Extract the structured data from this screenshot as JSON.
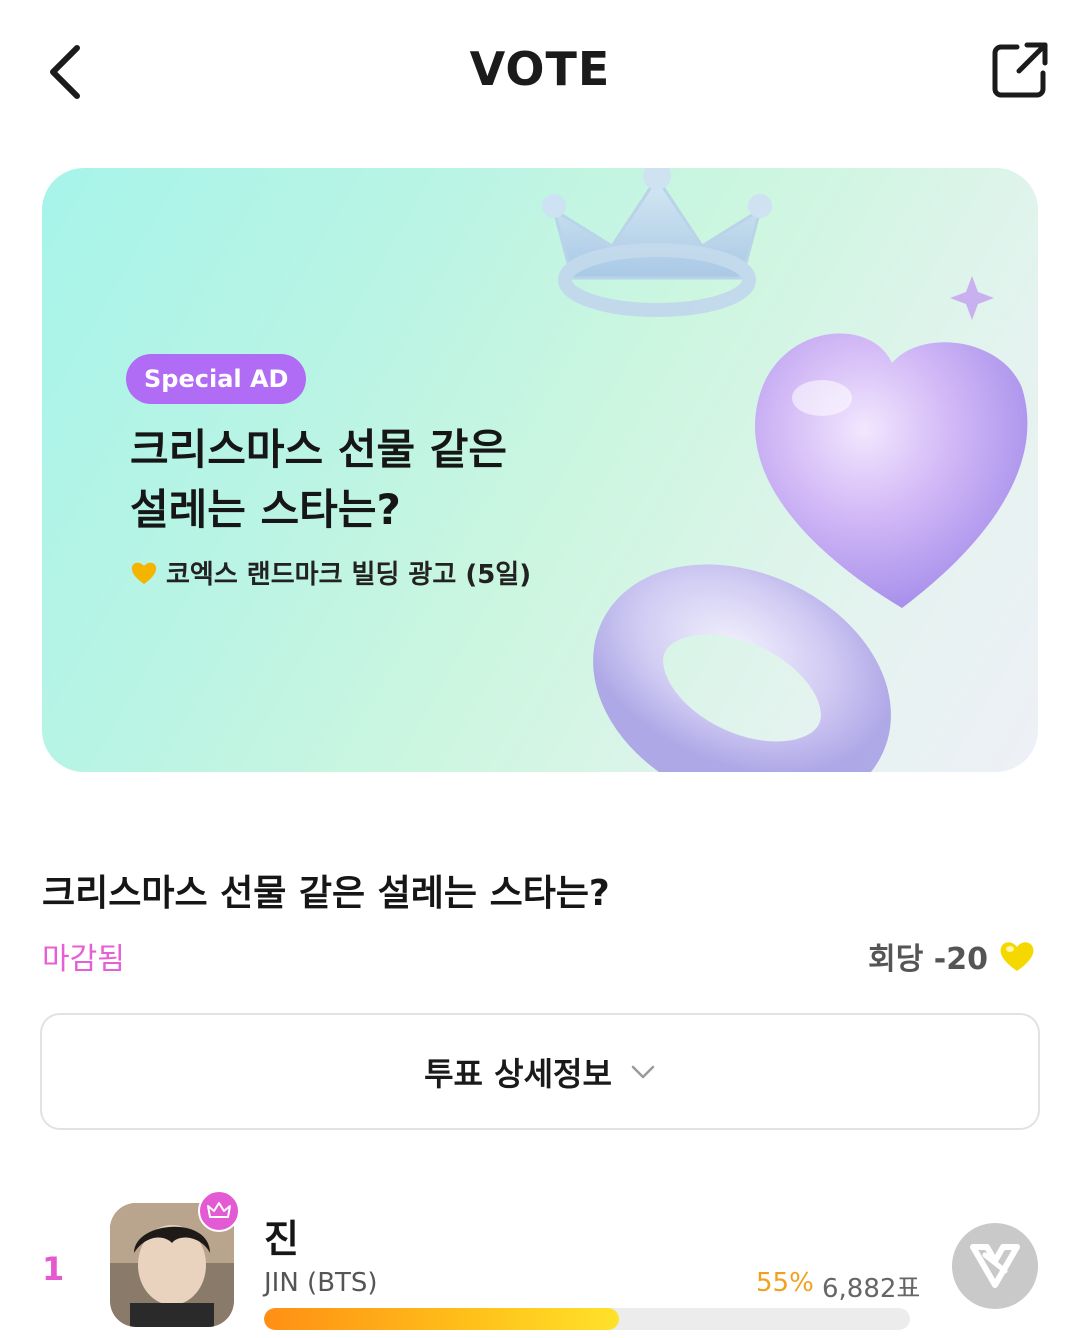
{
  "header": {
    "title": "VOTE",
    "back_icon": "chevron-left-icon",
    "share_icon": "share-external-icon"
  },
  "banner": {
    "badge": "Special AD",
    "title_line1": "크리스마스 선물 같은",
    "title_line2": "설레는 스타는?",
    "subtitle": "코엑스 랜드마크 빌딩 광고 (5일)",
    "heart_color": "#f5b400"
  },
  "vote": {
    "title": "크리스마스 선물 같은 설레는 스타는?",
    "status": "마감됨",
    "cost_label": "회당 -20",
    "details_label": "투표 상세정보"
  },
  "ranking": [
    {
      "rank": "1",
      "name": "진",
      "sub_name": "JIN (BTS)",
      "percent_label": "55%",
      "percent": 55,
      "votes": "6,882표"
    }
  ],
  "colors": {
    "accent_pink": "#e65fd6",
    "badge_purple": "#b06cf5",
    "bar_orange": "#ff8f14",
    "bar_yellow": "#ffe22a",
    "heart_yellow": "#f5d800"
  }
}
